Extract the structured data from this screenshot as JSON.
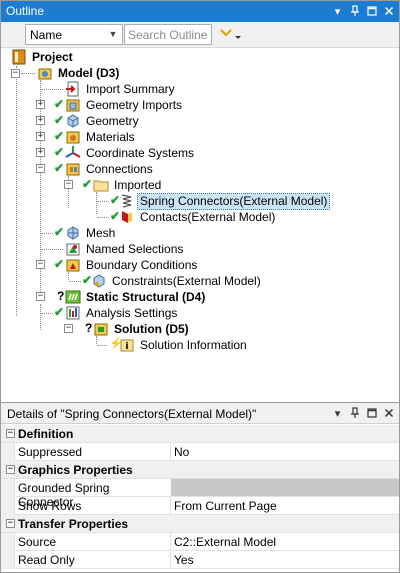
{
  "outline": {
    "title": "Outline",
    "icons": [
      "dropdown-icon",
      "pin-icon",
      "maximize-icon",
      "close-icon"
    ],
    "toolbar": {
      "name_select": "Name",
      "search_placeholder": "Search Outline"
    },
    "tree": {
      "project": "Project",
      "model": "Model (D3)",
      "import_summary": "Import Summary",
      "geometry_imports": "Geometry Imports",
      "geometry": "Geometry",
      "materials": "Materials",
      "coordinate_systems": "Coordinate Systems",
      "connections": "Connections",
      "imported": "Imported",
      "spring_connectors": "Spring Connectors(External Model)",
      "contacts": "Contacts(External Model)",
      "mesh": "Mesh",
      "named_selections": "Named Selections",
      "boundary_conditions": "Boundary Conditions",
      "constraints": "Constraints(External Model)",
      "static_structural": "Static Structural (D4)",
      "analysis_settings": "Analysis Settings",
      "solution": "Solution (D5)",
      "solution_information": "Solution Information"
    }
  },
  "details": {
    "title": "Details of \"Spring Connectors(External Model)\"",
    "sections": {
      "definition": "Definition",
      "graphics": "Graphics Properties",
      "transfer": "Transfer Properties"
    },
    "rows": {
      "suppressed_key": "Suppressed",
      "suppressed_val": "No",
      "grounded_key": "Grounded Spring Connector",
      "show_rows_key": "Show Rows",
      "show_rows_val": "From Current Page",
      "source_key": "Source",
      "source_val": "C2::External Model",
      "read_only_key": "Read Only",
      "read_only_val": "Yes"
    }
  },
  "colors": {
    "titlebar": "#1c7ccf",
    "selection": "#cce4f7",
    "check": "#1e9e2b",
    "chevron": "#e0a000"
  }
}
